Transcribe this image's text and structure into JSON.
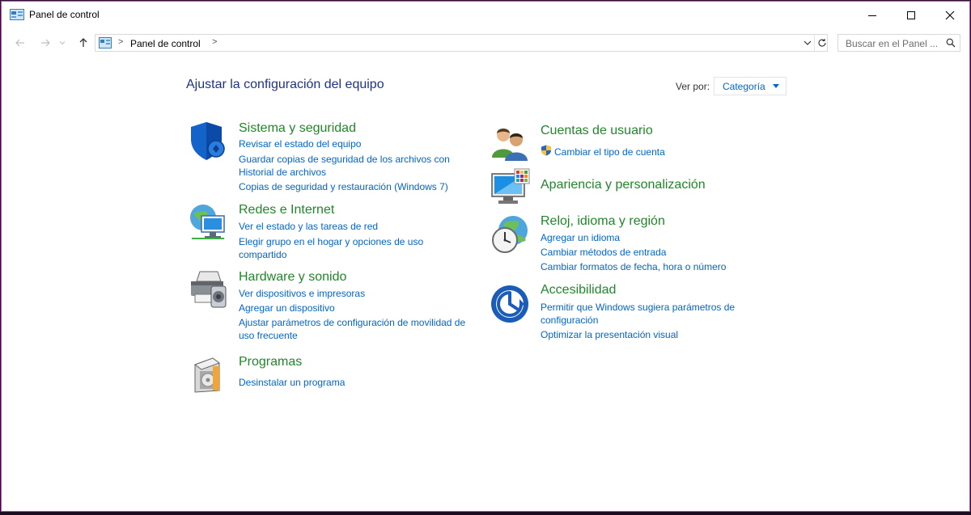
{
  "window": {
    "title": "Panel de control"
  },
  "address": {
    "crumb": "Panel de control"
  },
  "search": {
    "placeholder": "Buscar en el Panel ..."
  },
  "page_title": "Ajustar la configuración del equipo",
  "view_by": {
    "label": "Ver por:",
    "value": "Categoría"
  },
  "categories": {
    "security": {
      "title": "Sistema y seguridad",
      "links": [
        "Revisar el estado del equipo",
        "Guardar copias de seguridad de los archivos con",
        "Historial de archivos",
        "Copias de seguridad y restauración (Windows 7)"
      ]
    },
    "network": {
      "title": "Redes e Internet",
      "links": [
        "Ver el estado y las tareas de red",
        "Elegir grupo en el hogar y opciones de uso",
        "compartido"
      ]
    },
    "hardware": {
      "title": "Hardware y sonido",
      "links": [
        "Ver dispositivos e impresoras",
        "Agregar un dispositivo",
        "Ajustar parámetros de configuración de movilidad de",
        "uso frecuente"
      ]
    },
    "programs": {
      "title": "Programas",
      "links": [
        "Desinstalar un programa"
      ]
    },
    "users": {
      "title": "Cuentas de usuario",
      "links": [
        "Cambiar el tipo de cuenta"
      ]
    },
    "appearance": {
      "title": "Apariencia y personalización",
      "links": []
    },
    "clock": {
      "title": "Reloj, idioma y región",
      "links": [
        "Agregar un idioma",
        "Cambiar métodos de entrada",
        "Cambiar formatos de fecha, hora o número"
      ]
    },
    "access": {
      "title": "Accesibilidad",
      "links": [
        "Permitir que Windows sugiera parámetros de",
        "configuración",
        "Optimizar la presentación visual"
      ]
    }
  },
  "icons": {
    "app": "control-panel-icon",
    "security": "shield-icon",
    "network": "network-globe-icon",
    "hardware": "printer-icon",
    "programs": "programs-box-icon",
    "users": "users-icon",
    "appearance": "monitor-palette-icon",
    "clock": "clock-globe-icon",
    "access": "accessibility-icon"
  },
  "colors": {
    "category_title": "#20872a",
    "link": "#0066cc",
    "page_title": "#1e3287",
    "window_border": "#b44fb0"
  }
}
